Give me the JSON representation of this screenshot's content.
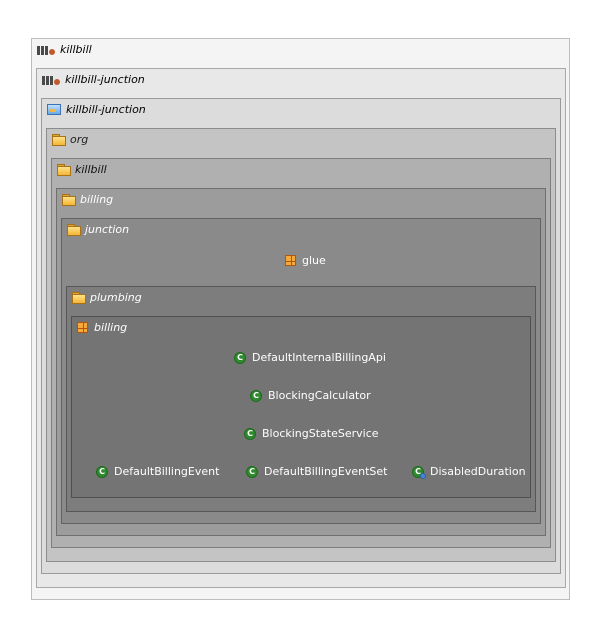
{
  "tree": {
    "module_root": {
      "label": "killbill",
      "icon": "maven-module-icon"
    },
    "module": {
      "label": "killbill-junction",
      "icon": "maven-module-icon"
    },
    "source_folder": {
      "label": "killbill-junction",
      "icon": "source-folder-icon"
    },
    "org": {
      "label": "org",
      "icon": "folder-icon"
    },
    "killbill": {
      "label": "killbill",
      "icon": "folder-icon"
    },
    "billing": {
      "label": "billing",
      "icon": "folder-icon"
    },
    "junction": {
      "label": "junction",
      "icon": "folder-icon"
    },
    "glue": {
      "label": "glue",
      "icon": "package-icon"
    },
    "plumbing": {
      "label": "plumbing",
      "icon": "folder-icon"
    },
    "plumbing_billing": {
      "label": "billing",
      "icon": "package-icon"
    },
    "classes": [
      {
        "label": "DefaultInternalBillingApi",
        "icon": "class-icon"
      },
      {
        "label": "BlockingCalculator",
        "icon": "class-icon"
      },
      {
        "label": "BlockingStateService",
        "icon": "class-icon"
      },
      {
        "label": "DefaultBillingEvent",
        "icon": "class-icon"
      },
      {
        "label": "DefaultBillingEventSet",
        "icon": "class-icon"
      },
      {
        "label": "DisabledDuration",
        "icon": "inner-class-icon"
      }
    ]
  },
  "colors": {
    "level0": "#f4f4f4",
    "level1": "#e8e8e8",
    "level2": "#dcdcdc",
    "level3": "#c4c4c4",
    "level4": "#b0b0b0",
    "level5": "#9c9c9c",
    "level6": "#8a8a8a",
    "level7": "#7d7d7d",
    "level8": "#747474",
    "class_badge": "#2f8a2f",
    "package_icon": "#f6a93b"
  }
}
